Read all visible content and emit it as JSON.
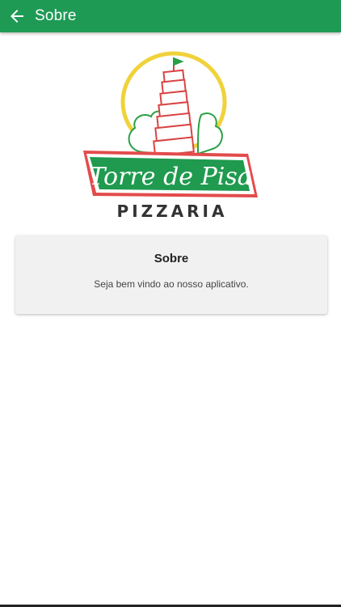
{
  "appbar": {
    "title": "Sobre",
    "back_icon": "arrow-left-icon",
    "color": "#1e9a55"
  },
  "logo": {
    "name_text": "Torre de Pisa",
    "subtitle_text": "PIZZARIA",
    "colors": {
      "green": "#1f9a4f",
      "red": "#e34b4b",
      "yellow": "#f0d23a",
      "tree_green": "#2aa046"
    }
  },
  "card": {
    "title": "Sobre",
    "text": "Seja bem vindo ao nosso aplicativo."
  }
}
